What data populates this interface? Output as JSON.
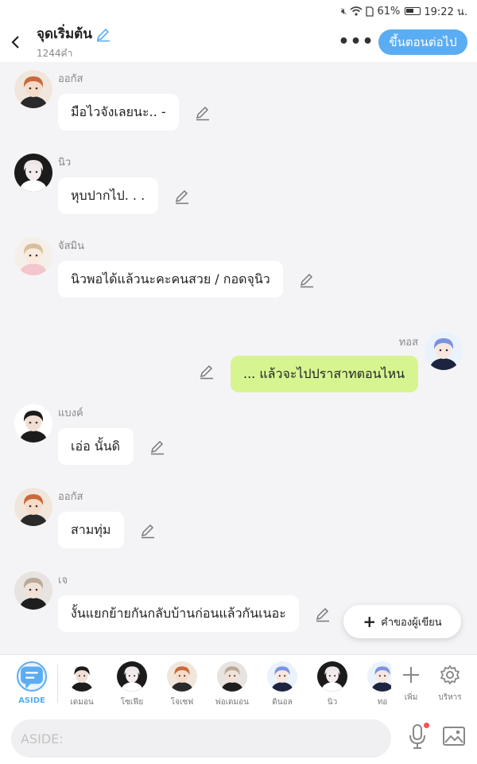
{
  "status_bar": {
    "battery": "61%",
    "time": "19:22 น.",
    "icons": [
      "mute-icon",
      "wifi-icon",
      "sim-icon",
      "battery-icon"
    ]
  },
  "header": {
    "title": "จุดเริ่มต้น",
    "subtitle": "1244คำ",
    "next_label": "ขึ้นตอนต่อไป",
    "more_label": "•••"
  },
  "messages": [
    {
      "sender": "ออกัส",
      "text": "มือไวจังเลยนะ.. -",
      "self": false,
      "avatar": "character-augus"
    },
    {
      "sender": "นิว",
      "text": "หุบปากไป. . .",
      "self": false,
      "avatar": "character-new"
    },
    {
      "sender": "จัสมิน",
      "text": "นิวพอได้แล้วนะคะคนสวย / กอดจุนิว",
      "self": false,
      "avatar": "character-jasmine"
    },
    {
      "sender": "ทอส",
      "text": "... แล้วจะไปปราสาทตอนไหน",
      "self": true,
      "avatar": "character-tos"
    },
    {
      "sender": "แบงค์",
      "text": "เอ่อ นั้นดิ",
      "self": false,
      "avatar": "character-bank"
    },
    {
      "sender": "ออกัส",
      "text": "สามทุ่ม",
      "self": false,
      "avatar": "character-augus"
    },
    {
      "sender": "เจ",
      "text": "งั้นแยกย้ายกันกลับบ้านก่อนแล้วกันเนอะ",
      "self": false,
      "avatar": "character-j"
    }
  ],
  "author_note_label": "คำของผู้เขียน",
  "characters": [
    {
      "name": "ASIDE"
    },
    {
      "name": "เดมอน"
    },
    {
      "name": "โซเฟีย"
    },
    {
      "name": "โจเซฟ"
    },
    {
      "name": "พ่อเดมอน"
    },
    {
      "name": "ดินอล"
    },
    {
      "name": "นิว"
    },
    {
      "name": "ทอ"
    }
  ],
  "tools": {
    "add_label": "เพิ่ม",
    "manage_label": "บริหาร"
  },
  "input": {
    "placeholder": "ASIDE:"
  },
  "colors": {
    "accent": "#5aadf3",
    "self_bubble": "#d6f590",
    "background": "#f4f4f6",
    "mic_dot": "#ff4e4e"
  }
}
